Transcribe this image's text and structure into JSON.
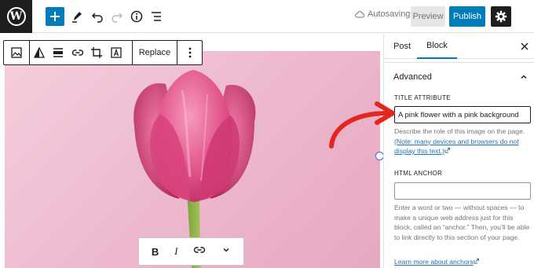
{
  "topbar": {
    "logo_letter": "W",
    "status": "Autosaving",
    "preview_label": "Preview",
    "publish_label": "Publish"
  },
  "block_toolbar": {
    "replace_label": "Replace"
  },
  "sidebar": {
    "tabs": [
      {
        "label": "Post",
        "active": false
      },
      {
        "label": "Block",
        "active": true
      }
    ],
    "section_title": "Advanced",
    "title_attribute": {
      "label": "TITLE ATTRIBUTE",
      "value": "A pink flower with a pink background",
      "help": "Describe the role of this image on the page.",
      "help_link": "(Note: many devices and browsers do not display this text.)"
    },
    "html_anchor": {
      "label": "HTML ANCHOR",
      "value": "",
      "help": "Enter a word or two — without spaces — to make a unique web address just for this block, called an “anchor.” Then, you’ll be able to link directly to this section of your page.",
      "help_link": "Learn more about anchors"
    }
  },
  "colors": {
    "accent": "#007cba",
    "annotation_arrow": "#e5251f",
    "image_background": "#eebbd0"
  }
}
